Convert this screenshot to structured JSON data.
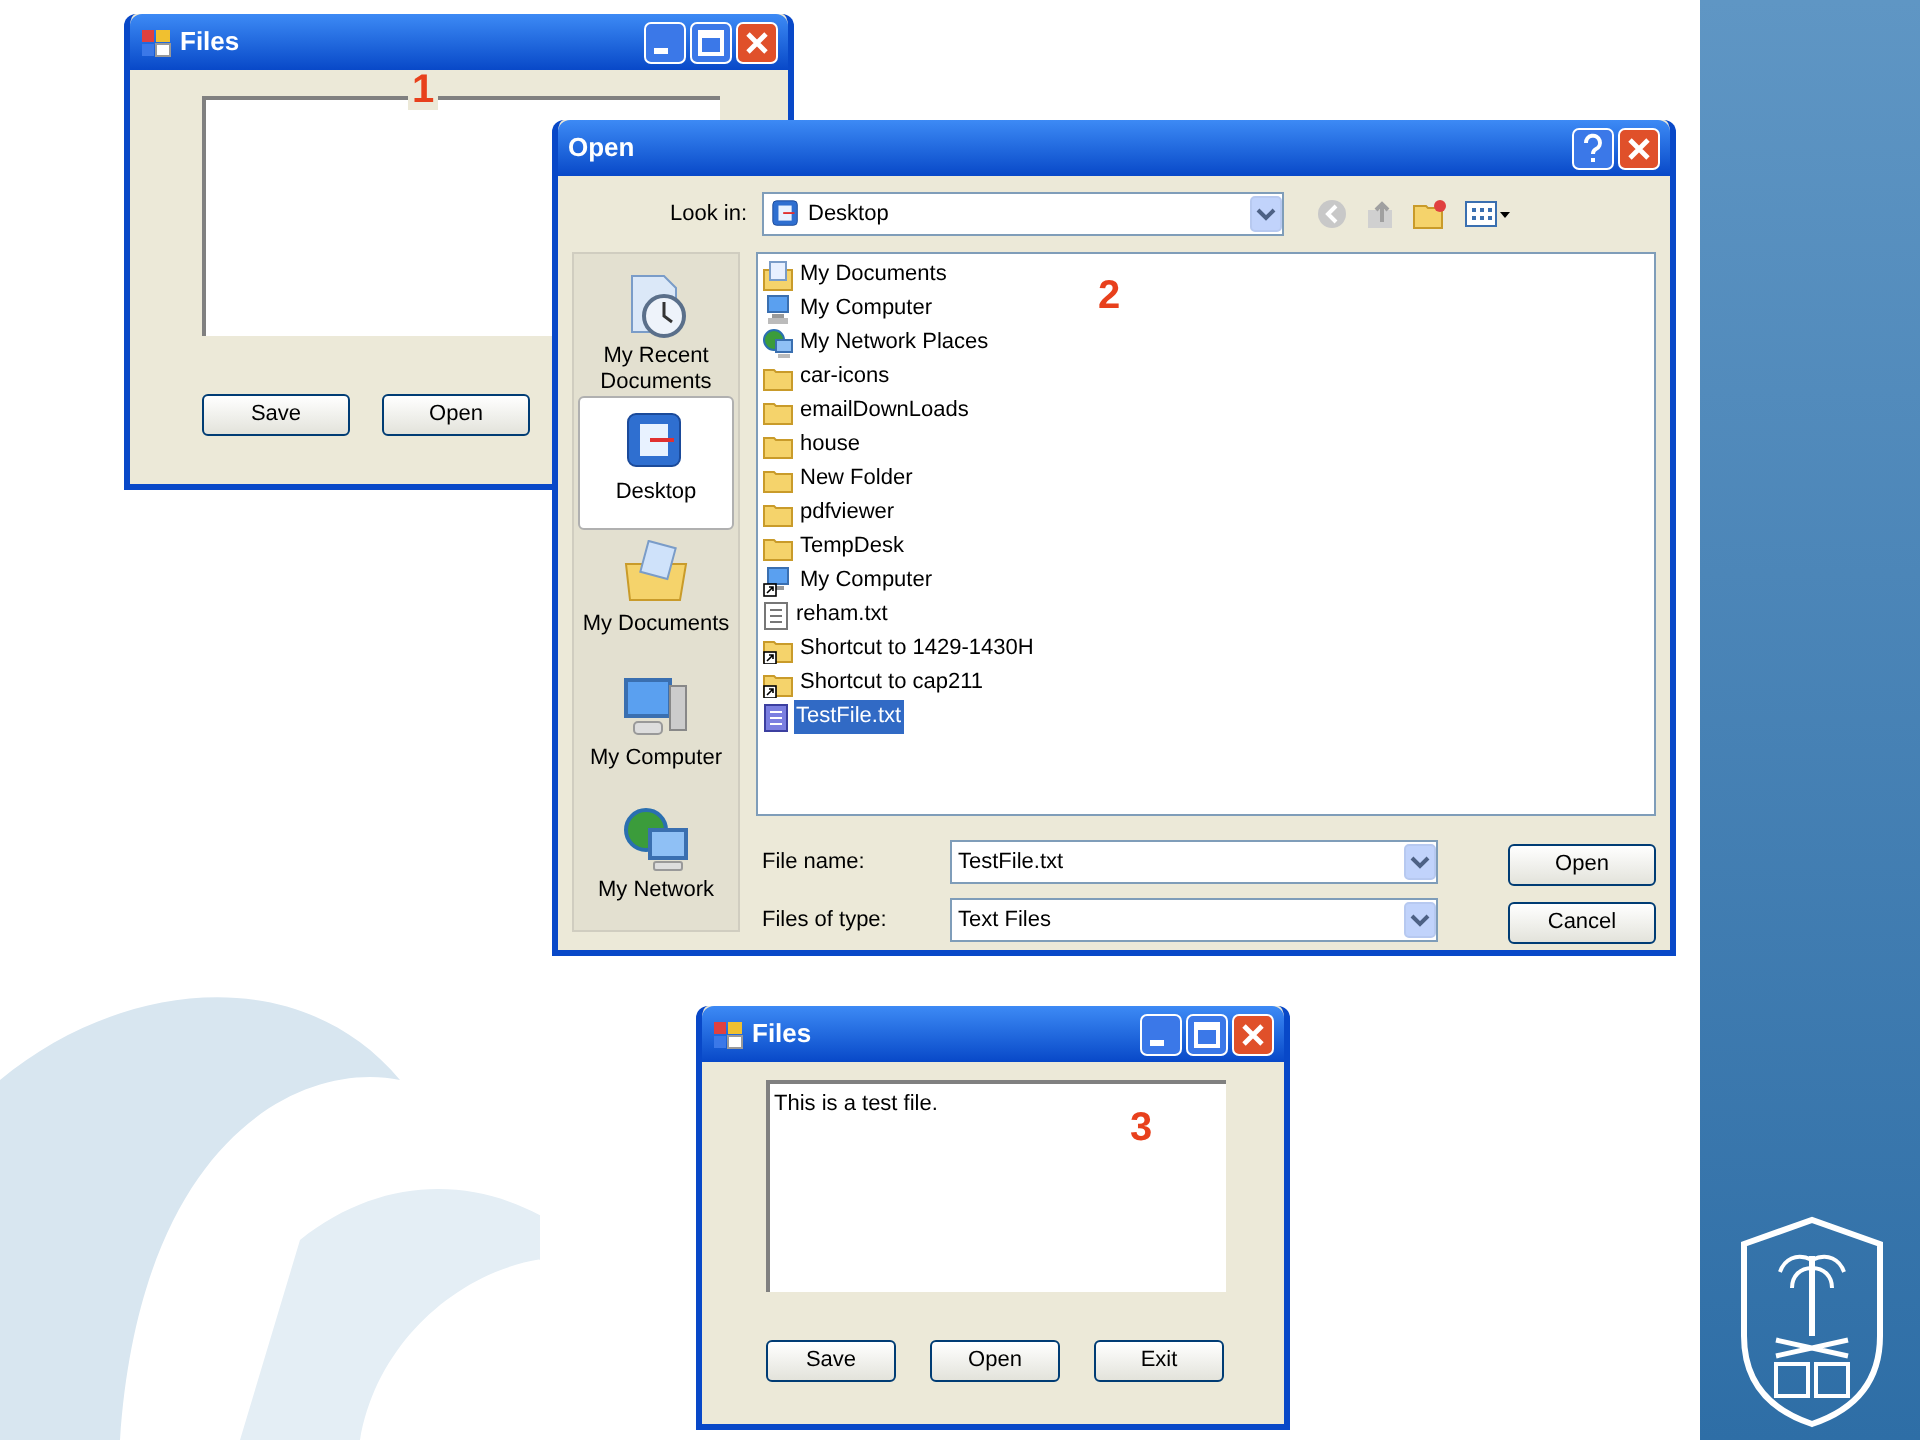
{
  "files_before": {
    "title": "Files",
    "callout": "1",
    "buttons": [
      "Save",
      "Open"
    ]
  },
  "open_dialog": {
    "title": "Open",
    "callout": "2",
    "look_in": {
      "label": "Look in:",
      "value": "Desktop"
    },
    "places": [
      {
        "label": "My Recent Documents",
        "kind": "recent",
        "selected": false
      },
      {
        "label": "Desktop",
        "kind": "desktop",
        "selected": true
      },
      {
        "label": "My Documents",
        "kind": "documents",
        "selected": false
      },
      {
        "label": "My Computer",
        "kind": "computer",
        "selected": false
      },
      {
        "label": "My Network",
        "kind": "network",
        "selected": false
      }
    ],
    "files": [
      {
        "name": "My Documents",
        "kind": "documents",
        "selected": false
      },
      {
        "name": "My Computer",
        "kind": "computer",
        "selected": false
      },
      {
        "name": "My Network Places",
        "kind": "network",
        "selected": false
      },
      {
        "name": "car-icons",
        "kind": "folder",
        "selected": false
      },
      {
        "name": "emailDownLoads",
        "kind": "folder",
        "selected": false
      },
      {
        "name": "house",
        "kind": "folder",
        "selected": false
      },
      {
        "name": "New Folder",
        "kind": "folder",
        "selected": false
      },
      {
        "name": "pdfviewer",
        "kind": "folder",
        "selected": false
      },
      {
        "name": "TempDesk",
        "kind": "folder",
        "selected": false
      },
      {
        "name": "My Computer",
        "kind": "computer_shortcut",
        "selected": false
      },
      {
        "name": "reham.txt",
        "kind": "text",
        "selected": false
      },
      {
        "name": "Shortcut to 1429-1430H",
        "kind": "folder_shortcut",
        "selected": false
      },
      {
        "name": "Shortcut to cap211",
        "kind": "folder_shortcut",
        "selected": false
      },
      {
        "name": "TestFile.txt",
        "kind": "text_file",
        "selected": true
      }
    ],
    "file_name": {
      "label": "File name:",
      "value": "TestFile.txt"
    },
    "file_type": {
      "label": "Files of type:",
      "value": "Text Files"
    },
    "buttons": [
      "Open",
      "Cancel"
    ]
  },
  "files_after": {
    "title": "Files",
    "callout": "3",
    "text_box": {
      "value": "This is a test file."
    },
    "buttons": [
      "Save",
      "Open",
      "Exit"
    ]
  }
}
